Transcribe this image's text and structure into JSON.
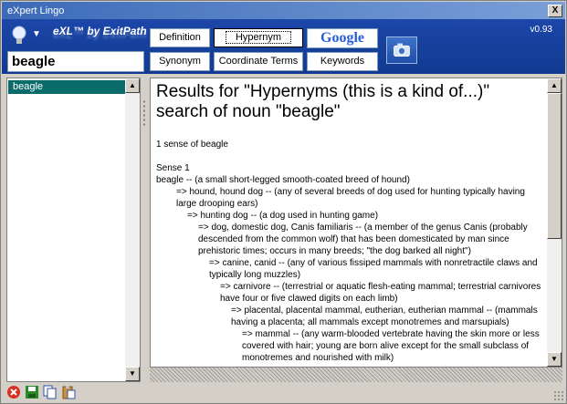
{
  "window": {
    "title": "eXpert Lingo",
    "close_label": "X"
  },
  "header": {
    "logo": "eXL™ by ExitPath",
    "version": "v0.93",
    "menu_arrow": "▼"
  },
  "search": {
    "value": "beagle"
  },
  "buttons": {
    "definition": "Definition",
    "hypernym": "Hypernym",
    "google": "Google",
    "synonym": "Synonym",
    "coordinate_terms": "Coordinate Terms",
    "keywords": "Keywords"
  },
  "wordlist": {
    "items": [
      "beagle"
    ]
  },
  "results": {
    "title": "Results for \"Hypernyms (this is a kind of...)\" search of noun \"beagle\"",
    "sense_count": "1 sense of beagle",
    "sense_label": "Sense 1",
    "lines": [
      "beagle -- (a small short-legged smooth-coated breed of hound)",
      "=> hound, hound dog -- (any of several breeds of dog used for hunting typically having large drooping ears)",
      "=> hunting dog -- (a dog used in hunting game)",
      "=> dog, domestic dog, Canis familiaris -- (a member of the genus Canis (probably descended from the common wolf) that has been domesticated by man since prehistoric times; occurs in many breeds; \"the dog barked all night\")",
      "=> canine, canid -- (any of various fissiped mammals with nonretractile claws and typically long muzzles)",
      "=> carnivore -- (terrestrial or aquatic flesh-eating mammal; terrestrial carnivores have four or five clawed digits on each limb)",
      "=> placental, placental mammal, eutherian, eutherian mammal -- (mammals having a placenta; all mammals except monotremes and marsupials)",
      "=> mammal -- (any warm-blooded vertebrate having the skin more or less covered with hair; young are born alive except for the small subclass of monotremes and nourished with milk)"
    ]
  },
  "colors": {
    "header_bg": "#1c46a8",
    "selected_item_bg": "#0a6b6b",
    "titlebar": "#3c6ab8"
  }
}
